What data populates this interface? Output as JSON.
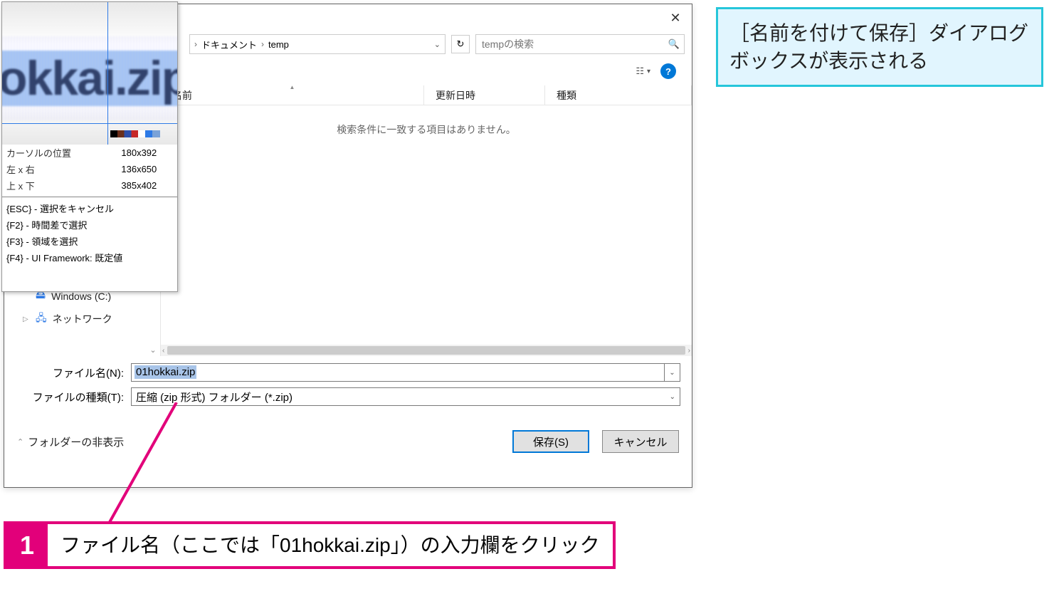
{
  "dialog": {
    "close": "✕",
    "breadcrumb": {
      "seg1": "ドキュメント",
      "seg2": "temp"
    },
    "refresh": "↻",
    "search_placeholder": "tempの検索",
    "columns": {
      "name": "名前",
      "date": "更新日時",
      "type": "種類"
    },
    "empty": "検索条件に一致する項目はありません。",
    "sidebar": {
      "drive": "Windows (C:)",
      "network": "ネットワーク"
    },
    "filename_label": "ファイル名(N):",
    "filename_value": "01hokkai.zip",
    "filetype_label": "ファイルの種類(T):",
    "filetype_value": "圧縮 (zip 形式) フォルダー (*.zip)",
    "hide_folders": "フォルダーの非表示",
    "save": "保存(S)",
    "cancel": "キャンセル"
  },
  "snip": {
    "zoom_text": "okkai.zip",
    "rows": [
      {
        "k": "カーソルの位置",
        "v": "180x392"
      },
      {
        "k": "左 x 右",
        "v": "136x650"
      },
      {
        "k": "上 x 下",
        "v": "385x402"
      }
    ],
    "shortcuts": [
      "{ESC} - 選択をキャンセル",
      "{F2}    - 時間差で選択",
      "{F3}    - 領域を選択",
      "{F4}    - UI Framework: 既定値"
    ]
  },
  "callouts": {
    "cyan": "［名前を付けて保存］ダイアログボックスが表示される",
    "magenta_num": "1",
    "magenta_text": "ファイル名（ここでは「01hokkai.zip」）の入力欄をクリック"
  }
}
